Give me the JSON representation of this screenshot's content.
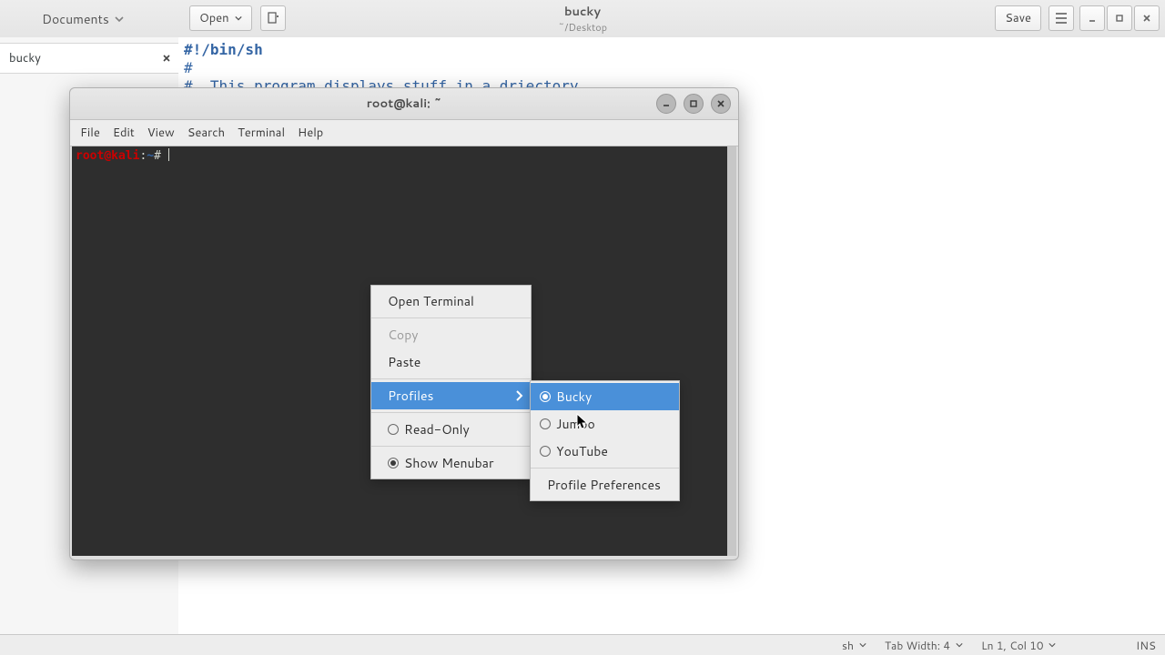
{
  "gedit": {
    "folder_label": "Documents",
    "open_label": "Open",
    "title": "bucky",
    "subtitle": "~/Desktop",
    "save_label": "Save",
    "tab_name": "bucky",
    "code_line1": "#!/bin/sh",
    "code_line2": "#",
    "code_line3": "#  This program displays stuff in a driectory",
    "status": {
      "lang": "sh",
      "tabw": "Tab Width: 4",
      "pos": "Ln 1, Col 10",
      "ins": "INS"
    }
  },
  "terminal": {
    "title": "root@kali: ~",
    "menus": [
      "File",
      "Edit",
      "View",
      "Search",
      "Terminal",
      "Help"
    ],
    "prompt_user": "root",
    "prompt_at": "@",
    "prompt_host": "kali",
    "prompt_colon": ":",
    "prompt_path": "~",
    "prompt_suffix": "# "
  },
  "ctx1": {
    "open_terminal": "Open Terminal",
    "copy": "Copy",
    "paste": "Paste",
    "profiles": "Profiles",
    "readonly": "Read-Only",
    "showmenubar": "Show Menubar"
  },
  "ctx2": {
    "items": [
      {
        "label": "Bucky",
        "checked": true
      },
      {
        "label": "Jumbo",
        "checked": false
      },
      {
        "label": "YouTube",
        "checked": false
      }
    ],
    "prefs": "Profile Preferences"
  }
}
